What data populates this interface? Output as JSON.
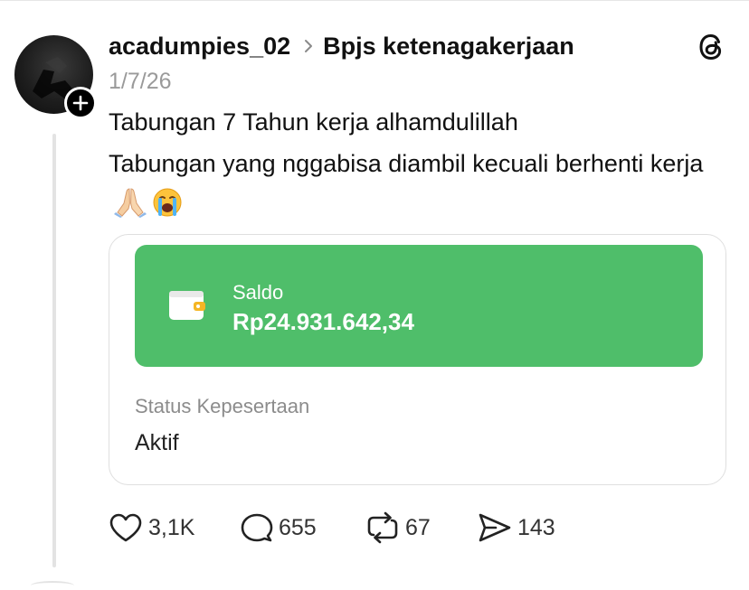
{
  "post": {
    "username": "acadumpies_02",
    "topic": "Bpjs ketenagakerjaan",
    "timestamp": "1/7/26",
    "text_line1": "Tabungan 7 Tahun kerja alhamdulillah",
    "text_line2": "Tabungan yang nggabisa diambil kecuali berhenti kerja",
    "emojis": [
      "folded-hands",
      "loudly-crying-face"
    ]
  },
  "card": {
    "saldo_label": "Saldo",
    "saldo_value": "Rp24.931.642,34",
    "status_label": "Status Kepesertaan",
    "status_value": "Aktif",
    "accent_color": "#4fbe6a"
  },
  "actions": {
    "likes": "3,1K",
    "replies": "655",
    "reposts": "67",
    "shares": "143"
  },
  "icons": [
    "heart-icon",
    "comment-icon",
    "repost-icon",
    "share-icon",
    "threads-logo-icon",
    "wallet-icon",
    "plus-icon"
  ]
}
